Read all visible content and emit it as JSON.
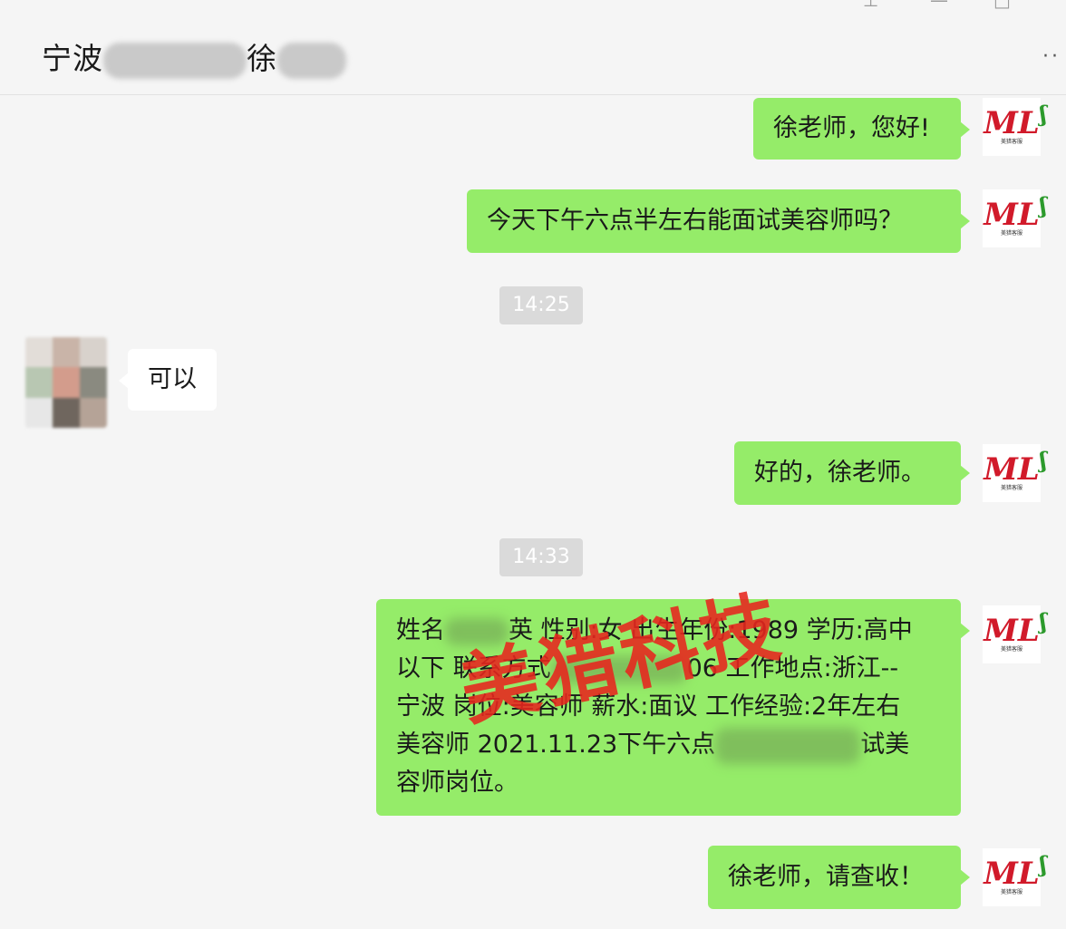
{
  "window": {
    "title_prefix": "宁波",
    "title_suffix": "徐",
    "more_label": "··",
    "controls": [
      "⊥",
      "—",
      "□"
    ]
  },
  "messages": [
    {
      "id": "m1",
      "side": "right",
      "text": "徐老师，您好!"
    },
    {
      "id": "m2",
      "side": "right",
      "text": "今天下午六点半左右能面试美容师吗？"
    },
    {
      "id": "t1",
      "type": "time",
      "text": "14:25"
    },
    {
      "id": "m3",
      "side": "left",
      "text": "可以"
    },
    {
      "id": "m4",
      "side": "right",
      "text": "好的，徐老师。"
    },
    {
      "id": "t2",
      "type": "time",
      "text": "14:33"
    },
    {
      "id": "m5",
      "side": "right",
      "type": "long",
      "lines": [
        {
          "a": "姓名",
          "b": "英 性别:女 出生年份:1989 学历:高中"
        },
        {
          "a": "以下 联系方式",
          "b": "06 工作地点:浙江--"
        },
        {
          "a": "宁波 岗位:美容师 薪水:面议 工作经验:2年左右",
          "b": ""
        },
        {
          "a": "美容师 2021.11.23下午六点",
          "b": "试美"
        },
        {
          "a": "容师岗位。",
          "b": ""
        }
      ]
    },
    {
      "id": "m6",
      "side": "right",
      "text": "徐老师，请查收！"
    }
  ],
  "avatar": {
    "logo": "ML",
    "swoosh": "ʃ",
    "caption": "美猎客服"
  },
  "watermark": "美猎科技",
  "colors": {
    "bubble_sent": "#95ec69",
    "bubble_received": "#ffffff",
    "watermark": "#e8261e",
    "background": "#f5f5f5"
  }
}
